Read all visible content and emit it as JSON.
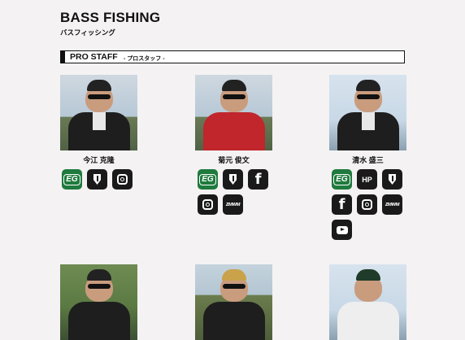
{
  "header": {
    "title": "BASS FISHING",
    "subtitle": "バスフィッシング"
  },
  "section": {
    "heading": "PRO STAFF",
    "subheading": "- プロスタッフ -"
  },
  "staff": [
    {
      "name": "今江 克隆",
      "icons": [
        "evergreen-logo",
        "blog-pen",
        "instagram"
      ]
    },
    {
      "name": "菊元 俊文",
      "icons": [
        "evergreen-logo",
        "blog-pen",
        "facebook",
        "instagram",
        "wave-media"
      ]
    },
    {
      "name": "清水 盛三",
      "icons": [
        "evergreen-logo",
        "homepage-hp",
        "blog-pen",
        "facebook",
        "instagram",
        "wave-media",
        "youtube"
      ]
    },
    {
      "name": "",
      "icons": []
    },
    {
      "name": "",
      "icons": []
    },
    {
      "name": "",
      "icons": []
    }
  ],
  "icon_labels": {
    "hp": "HP",
    "facebook": "f",
    "wave": "ᴢᴍᴡᴍ",
    "evergreen": "EG"
  },
  "colors": {
    "background": "#f4f2f3",
    "icon_dark": "#1a1a1a",
    "icon_green": "#1f7a3d"
  }
}
